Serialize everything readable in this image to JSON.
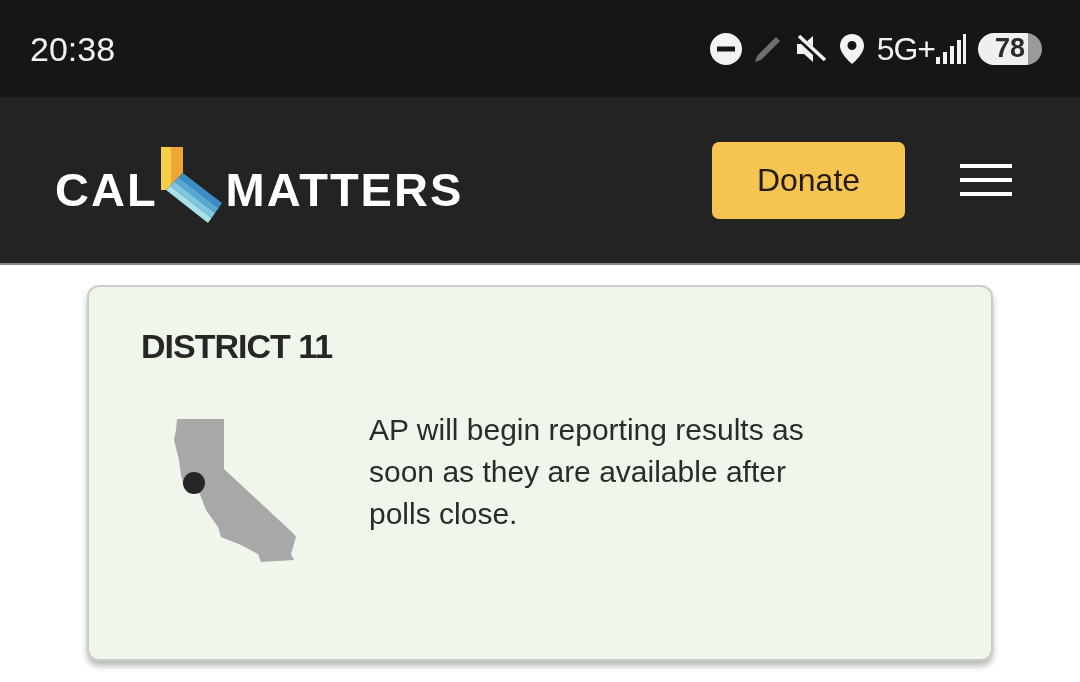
{
  "status_bar": {
    "time": "20:38",
    "network": "5G+",
    "battery": "78"
  },
  "header": {
    "logo": {
      "left": "CAL",
      "right": "MATTERS"
    },
    "donate_button": "Donate"
  },
  "district_card": {
    "title": "DISTRICT 11",
    "message": "AP will begin reporting results as soon as they are available after polls close."
  }
}
